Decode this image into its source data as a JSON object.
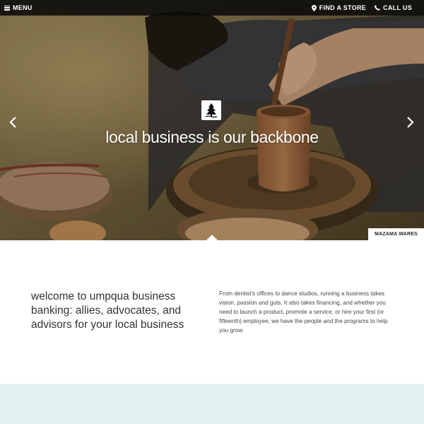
{
  "nav": {
    "menu_label": "MENU",
    "find_store_label": "FIND A STORE",
    "call_us_label": "CALL US"
  },
  "hero": {
    "headline": "local business is our backbone",
    "caption": "MAZAMA WARES",
    "prev_icon": "chevron-left-icon",
    "next_icon": "chevron-right-icon",
    "logo_icon": "tree-logo-icon"
  },
  "welcome": {
    "title": "welcome to umpqua business banking: allies, advocates, and advisors for your local business",
    "body": "From dentist's offices to dance studios, running a business takes vision, passion and guts. It also takes financing, and whether you need to launch a product, promote a service, or hire your first (or fifteenth) employee, we have the people and the programs to help you grow."
  },
  "colors": {
    "topbar": "#0a0a0a",
    "band": "#e3f1f3",
    "text": "#333333"
  }
}
